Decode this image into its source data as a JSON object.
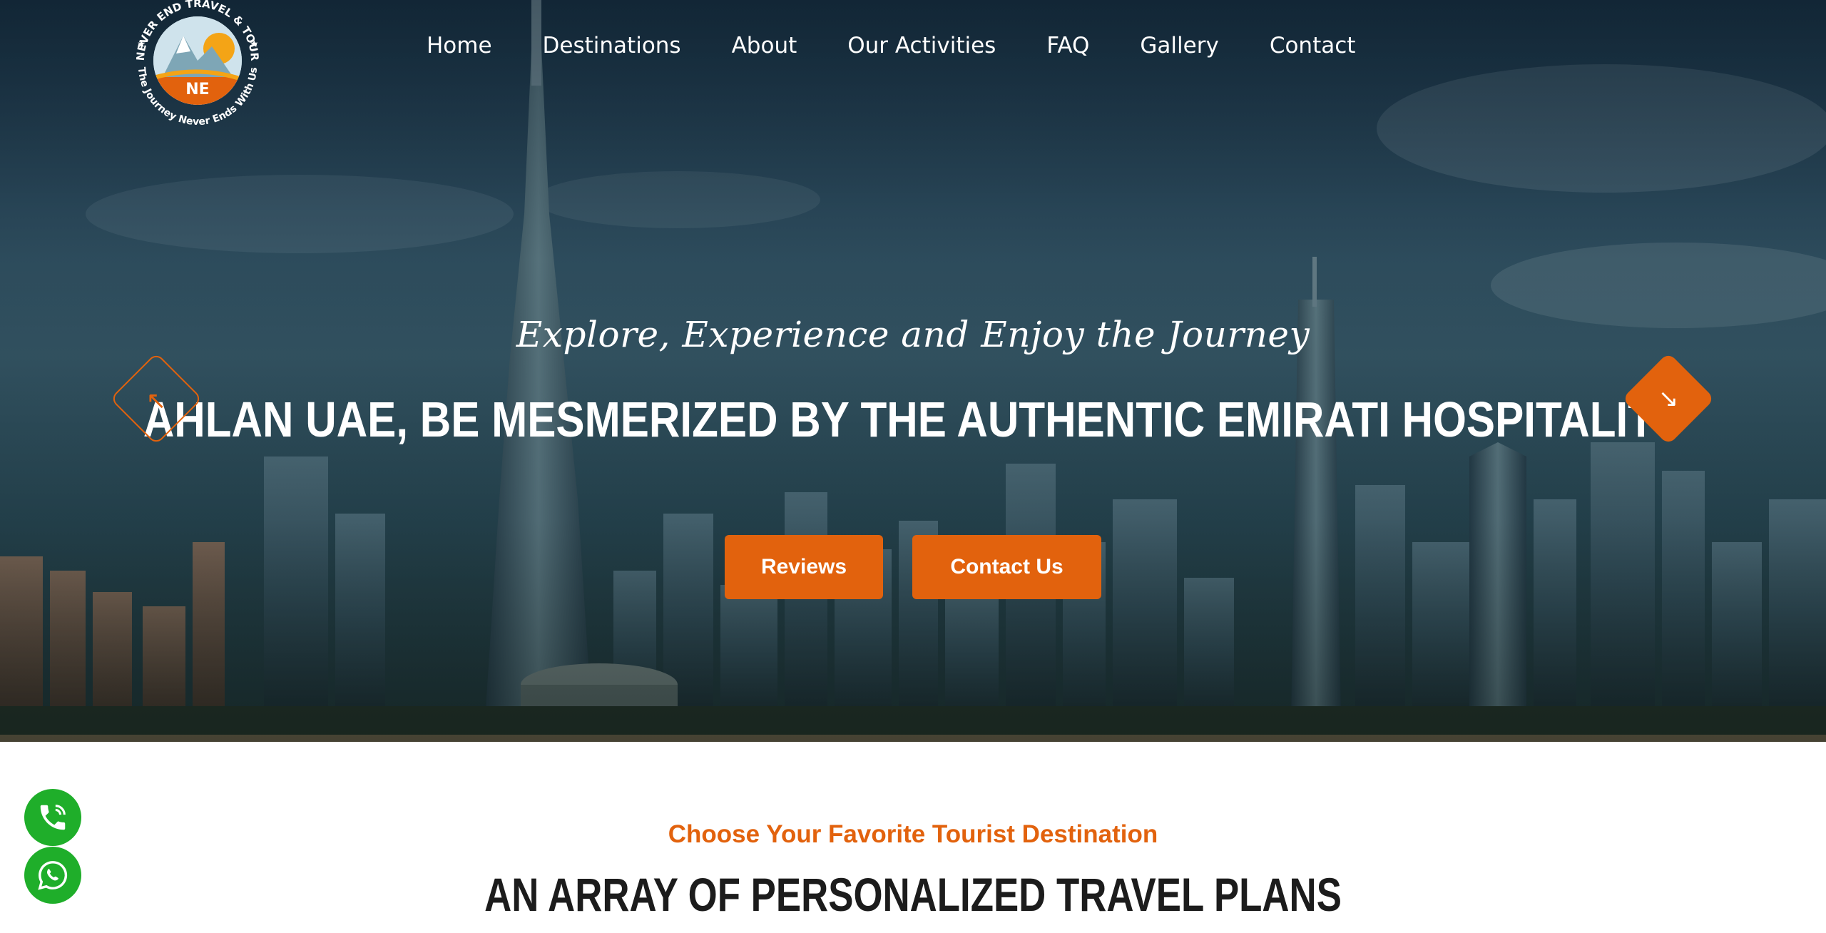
{
  "brand": {
    "logo_ring_top": "NEVER END TRAVEL & TOUR",
    "logo_ring_bottom": "The Journey Never Ends With Us",
    "logo_monogram": "NE"
  },
  "nav": {
    "items": [
      {
        "label": "Home"
      },
      {
        "label": "Destinations"
      },
      {
        "label": "About"
      },
      {
        "label": "Our Activities"
      },
      {
        "label": "FAQ"
      },
      {
        "label": "Gallery"
      },
      {
        "label": "Contact"
      }
    ]
  },
  "hero": {
    "tagline": "Explore, Experience and Enjoy the Journey",
    "headline": "AHLAN UAE, BE MESMERIZED BY THE AUTHENTIC EMIRATI HOSPITALITY",
    "buttons": {
      "reviews": "Reviews",
      "contact": "Contact Us"
    },
    "prev_icon": "arrow-up-left-icon",
    "next_icon": "arrow-down-right-icon"
  },
  "section": {
    "subtitle": "Choose Your Favorite Tourist Destination",
    "title": "AN ARRAY OF PERSONALIZED TRAVEL PLANS"
  },
  "floating": {
    "phone_icon": "phone-icon",
    "whatsapp_icon": "whatsapp-icon"
  },
  "colors": {
    "accent": "#e2620d",
    "whatsapp_green": "#1fae2a",
    "title_dark": "#1c1c1c"
  }
}
